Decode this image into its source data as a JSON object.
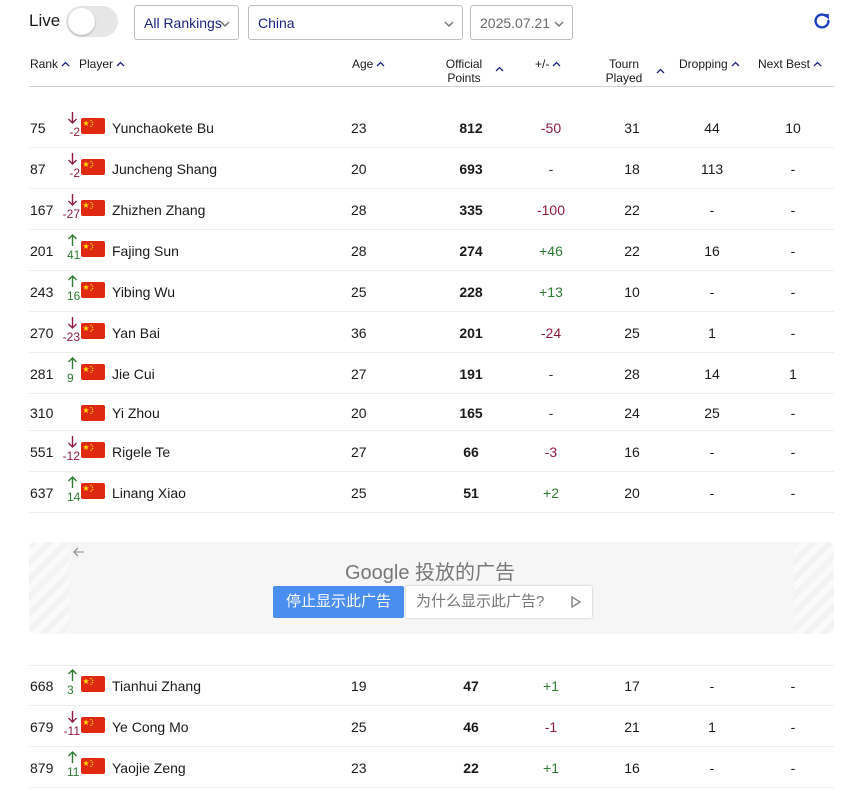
{
  "controls": {
    "live_label": "Live",
    "ranking_select": "All Rankings",
    "country_select": "China",
    "date_select": "2025.07.21"
  },
  "colors": {
    "accent": "#1a237e",
    "down": "#8e1b3c",
    "up": "#2e7d32",
    "ad_button": "#4a8ef0"
  },
  "icons": {
    "refresh": "refresh-icon",
    "sort": "sort-caret-icon",
    "flag": "china-flag-icon"
  },
  "headers": {
    "rank": "Rank",
    "player": "Player",
    "age": "Age",
    "points_line1": "Official",
    "points_line2": "Points",
    "diff": "+/-",
    "tourn_line1": "Tourn",
    "tourn_line2": "Played",
    "dropping": "Dropping",
    "next_best": "Next Best"
  },
  "rows": [
    {
      "rank": "75",
      "move": "-2",
      "dir": "down",
      "player": "Yunchaokete Bu",
      "age": "23",
      "points": "812",
      "diff": "-50",
      "tourn": "31",
      "dropping": "44",
      "next": "10"
    },
    {
      "rank": "87",
      "move": "-2",
      "dir": "down",
      "player": "Juncheng Shang",
      "age": "20",
      "points": "693",
      "diff": "-",
      "tourn": "18",
      "dropping": "113",
      "next": "-"
    },
    {
      "rank": "167",
      "move": "-27",
      "dir": "down",
      "player": "Zhizhen Zhang",
      "age": "28",
      "points": "335",
      "diff": "-100",
      "tourn": "22",
      "dropping": "-",
      "next": "-"
    },
    {
      "rank": "201",
      "move": "41",
      "dir": "up",
      "player": "Fajing Sun",
      "age": "28",
      "points": "274",
      "diff": "+46",
      "tourn": "22",
      "dropping": "16",
      "next": "-"
    },
    {
      "rank": "243",
      "move": "16",
      "dir": "up",
      "player": "Yibing Wu",
      "age": "25",
      "points": "228",
      "diff": "+13",
      "tourn": "10",
      "dropping": "-",
      "next": "-"
    },
    {
      "rank": "270",
      "move": "-23",
      "dir": "down",
      "player": "Yan Bai",
      "age": "36",
      "points": "201",
      "diff": "-24",
      "tourn": "25",
      "dropping": "1",
      "next": "-"
    },
    {
      "rank": "281",
      "move": "9",
      "dir": "up",
      "player": "Jie Cui",
      "age": "27",
      "points": "191",
      "diff": "-",
      "tourn": "28",
      "dropping": "14",
      "next": "1"
    },
    {
      "rank": "310",
      "move": "",
      "dir": "none",
      "player": "Yi Zhou",
      "age": "20",
      "points": "165",
      "diff": "-",
      "tourn": "24",
      "dropping": "25",
      "next": "-"
    },
    {
      "rank": "551",
      "move": "-12",
      "dir": "down",
      "player": "Rigele Te",
      "age": "27",
      "points": "66",
      "diff": "-3",
      "tourn": "16",
      "dropping": "-",
      "next": "-"
    },
    {
      "rank": "637",
      "move": "14",
      "dir": "up",
      "player": "Linang Xiao",
      "age": "25",
      "points": "51",
      "diff": "+2",
      "tourn": "20",
      "dropping": "-",
      "next": "-"
    },
    {
      "rank": "668",
      "move": "3",
      "dir": "up",
      "player": "Tianhui Zhang",
      "age": "19",
      "points": "47",
      "diff": "+1",
      "tourn": "17",
      "dropping": "-",
      "next": "-"
    },
    {
      "rank": "679",
      "move": "-11",
      "dir": "down",
      "player": "Ye Cong Mo",
      "age": "25",
      "points": "46",
      "diff": "-1",
      "tourn": "21",
      "dropping": "1",
      "next": "-"
    },
    {
      "rank": "879",
      "move": "11",
      "dir": "up",
      "player": "Yaojie Zeng",
      "age": "23",
      "points": "22",
      "diff": "+1",
      "tourn": "16",
      "dropping": "-",
      "next": "-"
    }
  ],
  "ad": {
    "brand": "Google 投放的广告",
    "stop_label": "停止显示此广告",
    "why_label": "为什么显示此广告?"
  }
}
